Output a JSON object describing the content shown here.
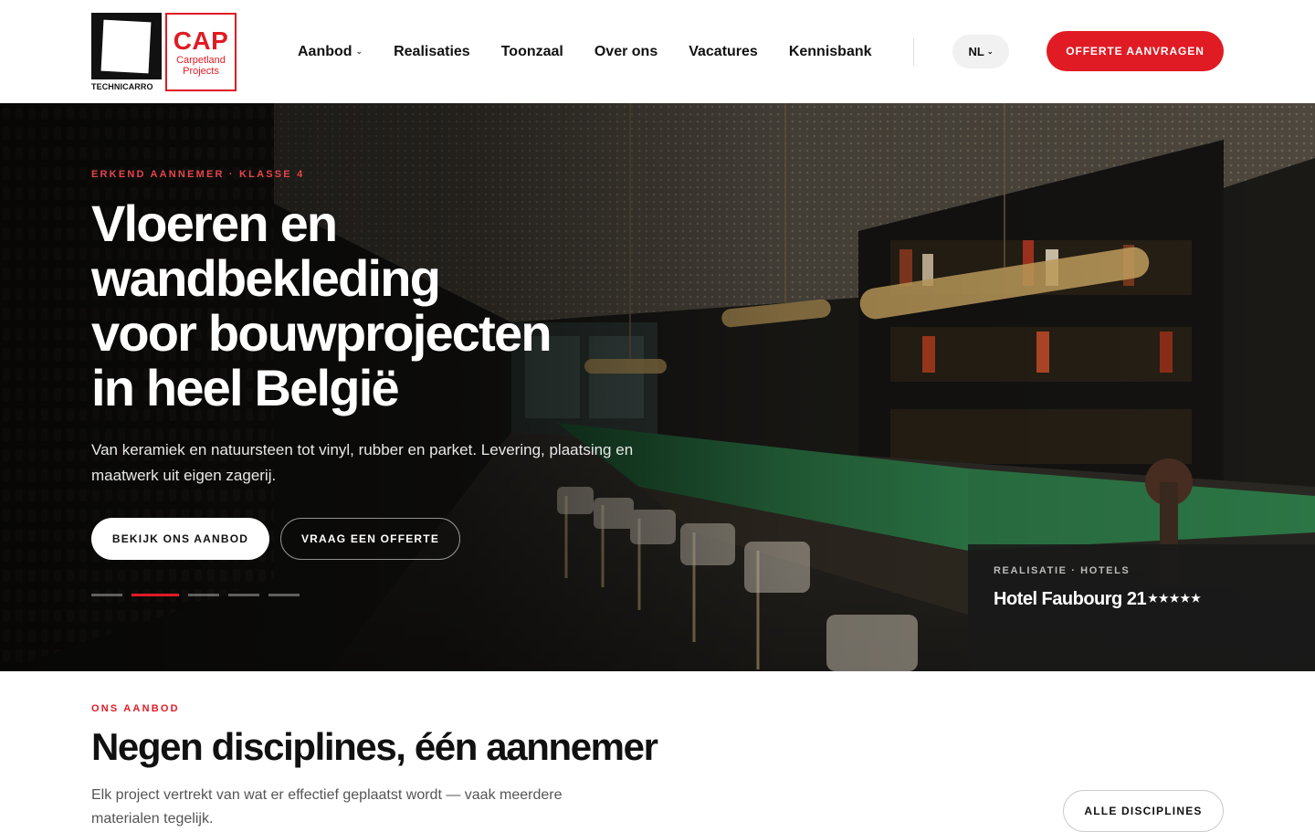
{
  "header": {
    "logo_techni_text": "TECHNICARRO",
    "logo_cap": {
      "big": "CAP",
      "line1": "Carpetland",
      "line2": "Projects"
    },
    "nav": [
      {
        "label": "Aanbod",
        "has_dropdown": true
      },
      {
        "label": "Realisaties"
      },
      {
        "label": "Toonzaal"
      },
      {
        "label": "Over ons"
      },
      {
        "label": "Vacatures"
      },
      {
        "label": "Kennisbank"
      }
    ],
    "language": "NL",
    "cta_label": "OFFERTE AANVRAGEN"
  },
  "hero": {
    "eyebrow": "ERKEND AANNEMER · KLASSE 4",
    "title_lines": [
      "Vloeren en",
      "wandbekleding",
      "voor bouwprojecten",
      "in heel België"
    ],
    "subtitle": "Van keramiek en natuursteen tot vinyl, rubber en parket. Levering, plaatsing en maatwerk uit eigen zagerij.",
    "btn_primary": "BEKIJK ONS AANBOD",
    "btn_secondary": "VRAAG EEN OFFERTE",
    "slides_total": 5,
    "slide_active": 2,
    "badge": {
      "label": "REALISATIE · HOTELS",
      "name": "Hotel Faubourg 21",
      "stars": "★★★★★"
    }
  },
  "section": {
    "eyebrow": "ONS AANBOD",
    "title": "Negen disciplines, één aannemer",
    "text": "Elk project vertrekt van wat er effectief geplaatst wordt — vaak meerdere materialen tegelijk.",
    "btn": "ALLE DISCIPLINES"
  },
  "colors": {
    "accent": "#e01b24",
    "bar_green": "#1f6b3c",
    "brass": "#b08a4a"
  }
}
